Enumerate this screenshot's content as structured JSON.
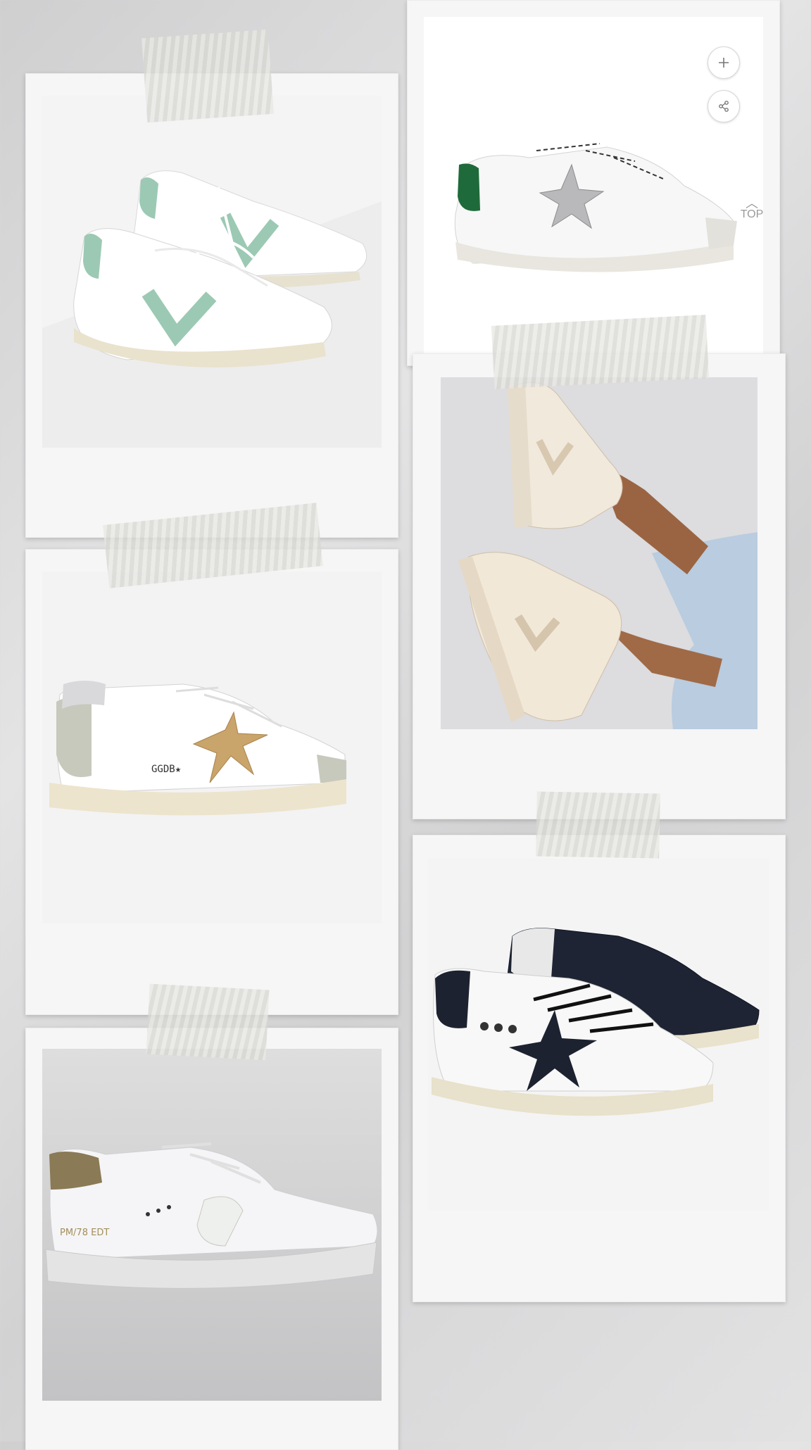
{
  "controls": {
    "add_icon": "plus-icon",
    "share_icon": "share-icon",
    "scroll_top_label": "TOP",
    "scroll_top_icon": "chevron-up-icon"
  },
  "items": [
    {
      "name": "Veja white sneakers with mint V",
      "accent": "#9cc9b4"
    },
    {
      "name": "White sneaker with green heel and silver glitter star",
      "accent": "#1f6a3a"
    },
    {
      "name": "Veja beige high-top sneakers on model",
      "accent": "#eadbc8"
    },
    {
      "name": "Golden Goose white sneaker with gold glitter star",
      "accent": "#c9a46b",
      "side_text": "GGDB★"
    },
    {
      "name": "Golden Goose white sneakers with black star",
      "accent": "#1d2230"
    },
    {
      "name": "Philippe Model white sneaker with gold croc heel",
      "accent": "#8a7a55",
      "side_text": "PM/78 EDT"
    }
  ]
}
